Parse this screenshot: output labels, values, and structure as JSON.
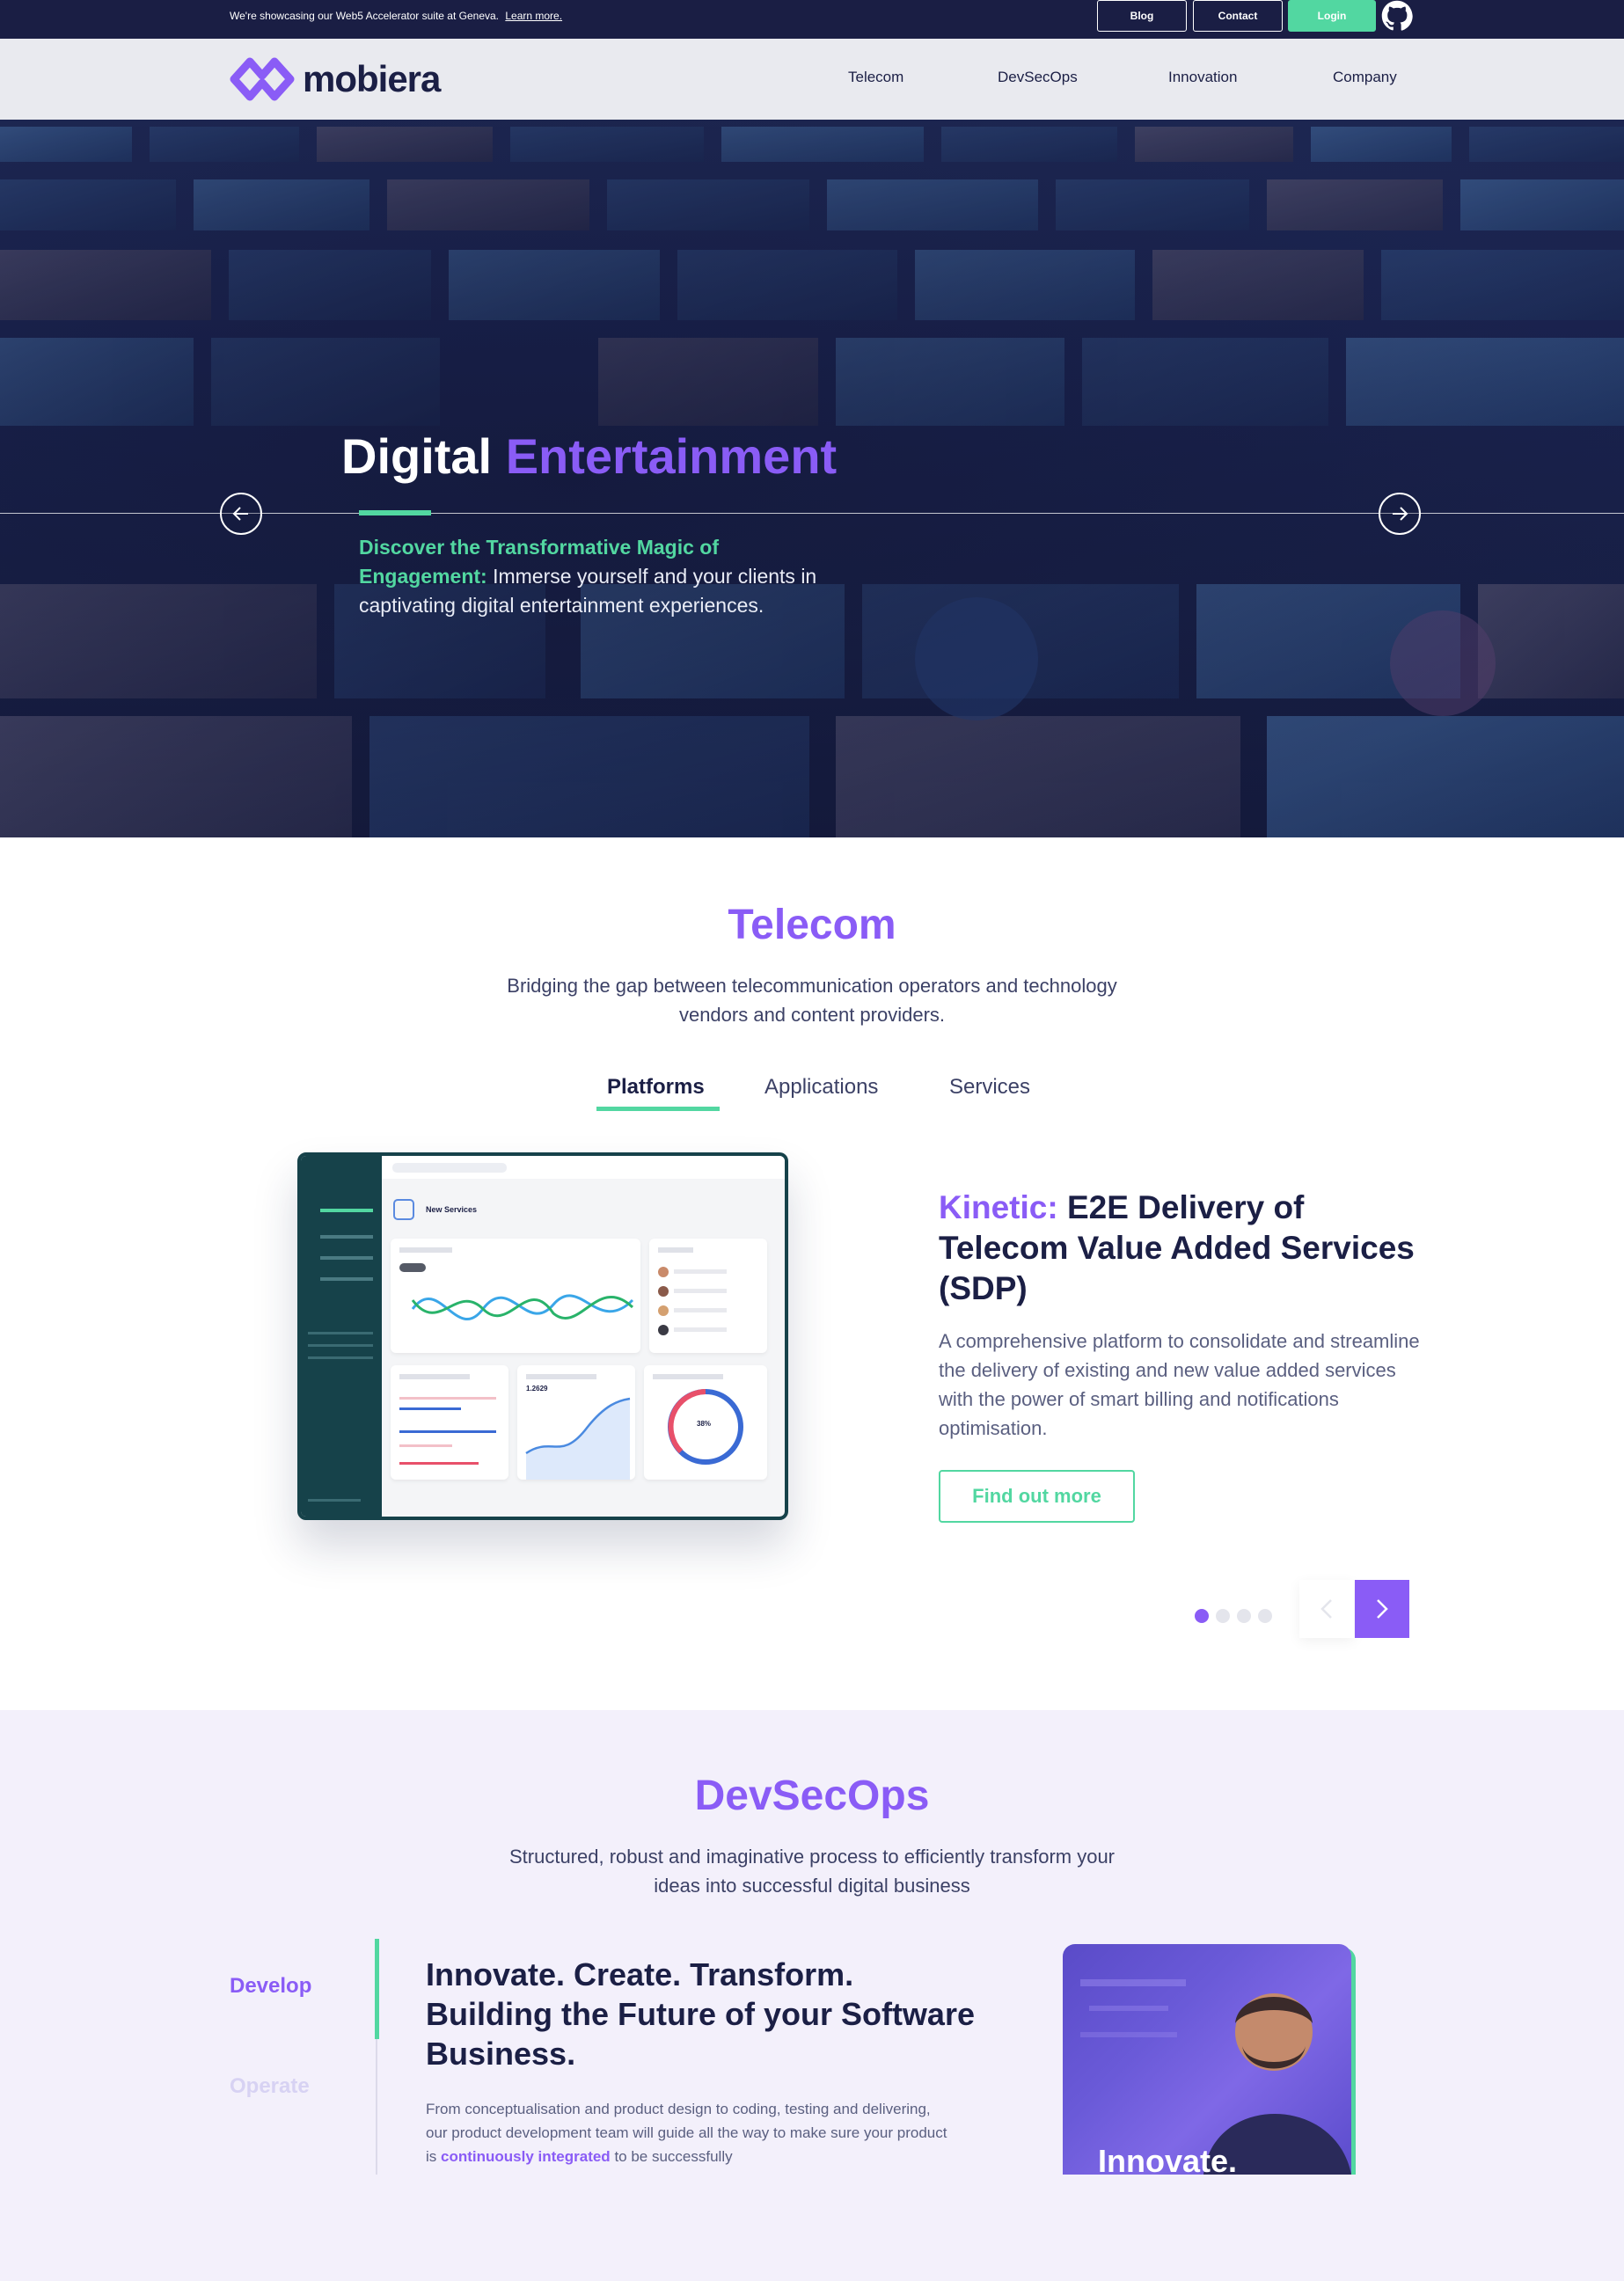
{
  "announcement": {
    "message": "We're showcasing our Web5 Accelerator suite at Geneva.",
    "link": "Learn more.",
    "blog": "Blog",
    "contact": "Contact",
    "login": "Login",
    "github_icon": "github-icon"
  },
  "nav": {
    "brand": "mobiera",
    "items": [
      "Telecom",
      "DevSecOps",
      "Innovation",
      "Company"
    ]
  },
  "hero": {
    "title_part1": "Digital",
    "title_part2": "Entertainment",
    "lead": "Discover the Transformative Magic of Engagement:",
    "text": "Immerse yourself and your clients in captivating digital entertainment experiences."
  },
  "telecom": {
    "title": "Telecom",
    "subtitle": "Bridging the gap between telecommunication operators and technology vendors and content providers.",
    "tabs": [
      "Platforms",
      "Applications",
      "Services"
    ],
    "active_tab": "Platforms",
    "product": {
      "name": "Kinetic:",
      "headline": "E2E Delivery of Telecom Value Added Services (SDP)",
      "description": "A comprehensive platform to consolidate and streamline the delivery of existing and new value added services with the power of smart billing and notifications optimisation.",
      "cta": "Find out more"
    },
    "mockup": {
      "label": "New Services",
      "figure": "1.2629",
      "percent": "38%"
    },
    "carousel": {
      "slides": 4,
      "active": 1
    }
  },
  "devsecops": {
    "title": "DevSecOps",
    "subtitle": "Structured, robust and imaginative process to efficiently transform your ideas into successful digital business",
    "tabs": [
      "Develop",
      "Operate"
    ],
    "headline": "Innovate. Create. Transform. Building the Future of your Software Business.",
    "desc_start": "From conceptualisation and product design to coding, testing and delivering, our product development team will guide all the way to make sure your product is",
    "desc_highlight": "continuously integrated",
    "desc_end": "to be successfully",
    "image_caption": "Innovate."
  },
  "colors": {
    "brand_purple": "#8a5cf6",
    "accent_green": "#52d7a1",
    "navy": "#1b1f45"
  }
}
